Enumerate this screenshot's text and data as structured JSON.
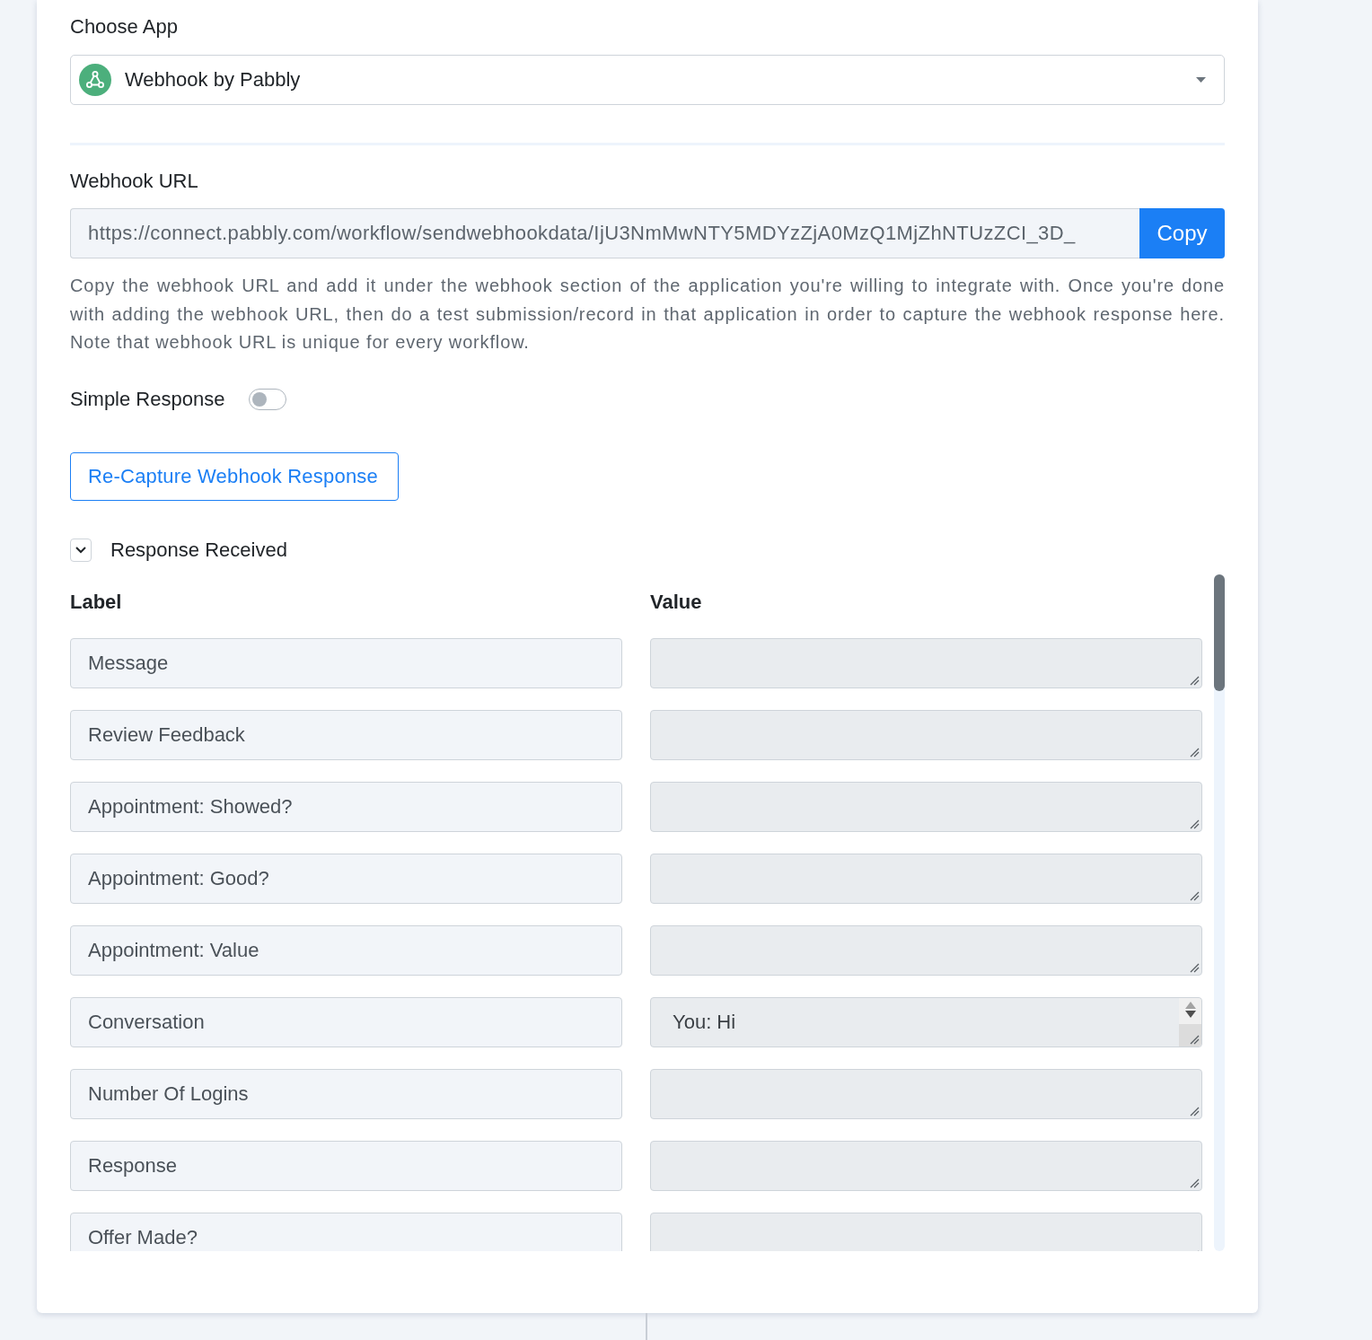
{
  "choose_app": {
    "label": "Choose App",
    "selected_app": "Webhook by Pabbly"
  },
  "webhook_url": {
    "label": "Webhook URL",
    "value": "https://connect.pabbly.com/workflow/sendwebhookdata/IjU3NmMwNTY5MDYzZjA0MzQ1MjZhNTUzZCI_3D_",
    "copy_button": "Copy",
    "help_text": "Copy the webhook URL and add it under the webhook section of the application you're willing to integrate with. Once you're done with adding the webhook URL, then do a test submission/record in that application in order to capture the webhook response here. Note that webhook URL is unique for every workflow."
  },
  "simple_response": {
    "label": "Simple Response",
    "on": false
  },
  "recapture_button": "Re-Capture Webhook Response",
  "response_received": {
    "label": "Response Received",
    "expanded": true
  },
  "response_table": {
    "columns": [
      "Label",
      "Value"
    ],
    "rows": [
      {
        "label": "Message",
        "scrollbar": false
      },
      {
        "label": "Review Feedback",
        "scrollbar": false
      },
      {
        "label": "Appointment: Showed?",
        "scrollbar": false
      },
      {
        "label": "Appointment: Good?",
        "scrollbar": false
      },
      {
        "label": "Appointment: Value",
        "scrollbar": false
      },
      {
        "label": "Conversation",
        "value": "You: Hi",
        "scrollbar": true
      },
      {
        "label": "Number Of Logins",
        "scrollbar": false
      },
      {
        "label": "Response",
        "scrollbar": false
      },
      {
        "label": "Offer Made?",
        "scrollbar": false
      }
    ]
  }
}
